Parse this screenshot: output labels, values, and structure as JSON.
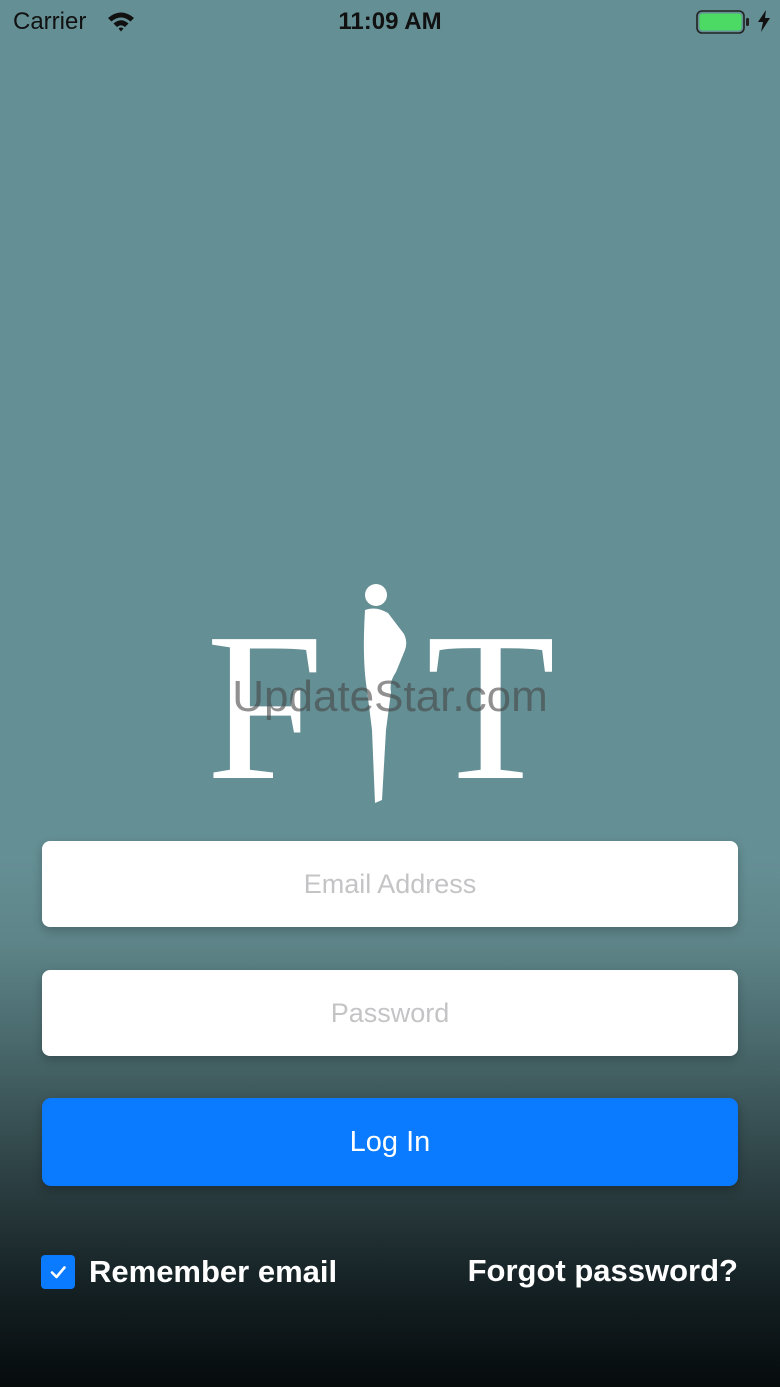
{
  "status_bar": {
    "carrier": "Carrier",
    "time": "11:09 AM",
    "icons": [
      "wifi-icon",
      "battery-icon",
      "charging-bolt-icon"
    ]
  },
  "logo": {
    "text": "FiT"
  },
  "watermark": {
    "text": "UpdateStar.com"
  },
  "form": {
    "email": {
      "value": "",
      "placeholder": "Email Address"
    },
    "password": {
      "value": "",
      "placeholder": "Password"
    },
    "login_label": "Log In",
    "remember_label": "Remember email",
    "remember_checked": true,
    "forgot_label": "Forgot password?"
  },
  "colors": {
    "background": "#648f94",
    "accent": "#0a7aff",
    "battery": "#4cd964"
  }
}
